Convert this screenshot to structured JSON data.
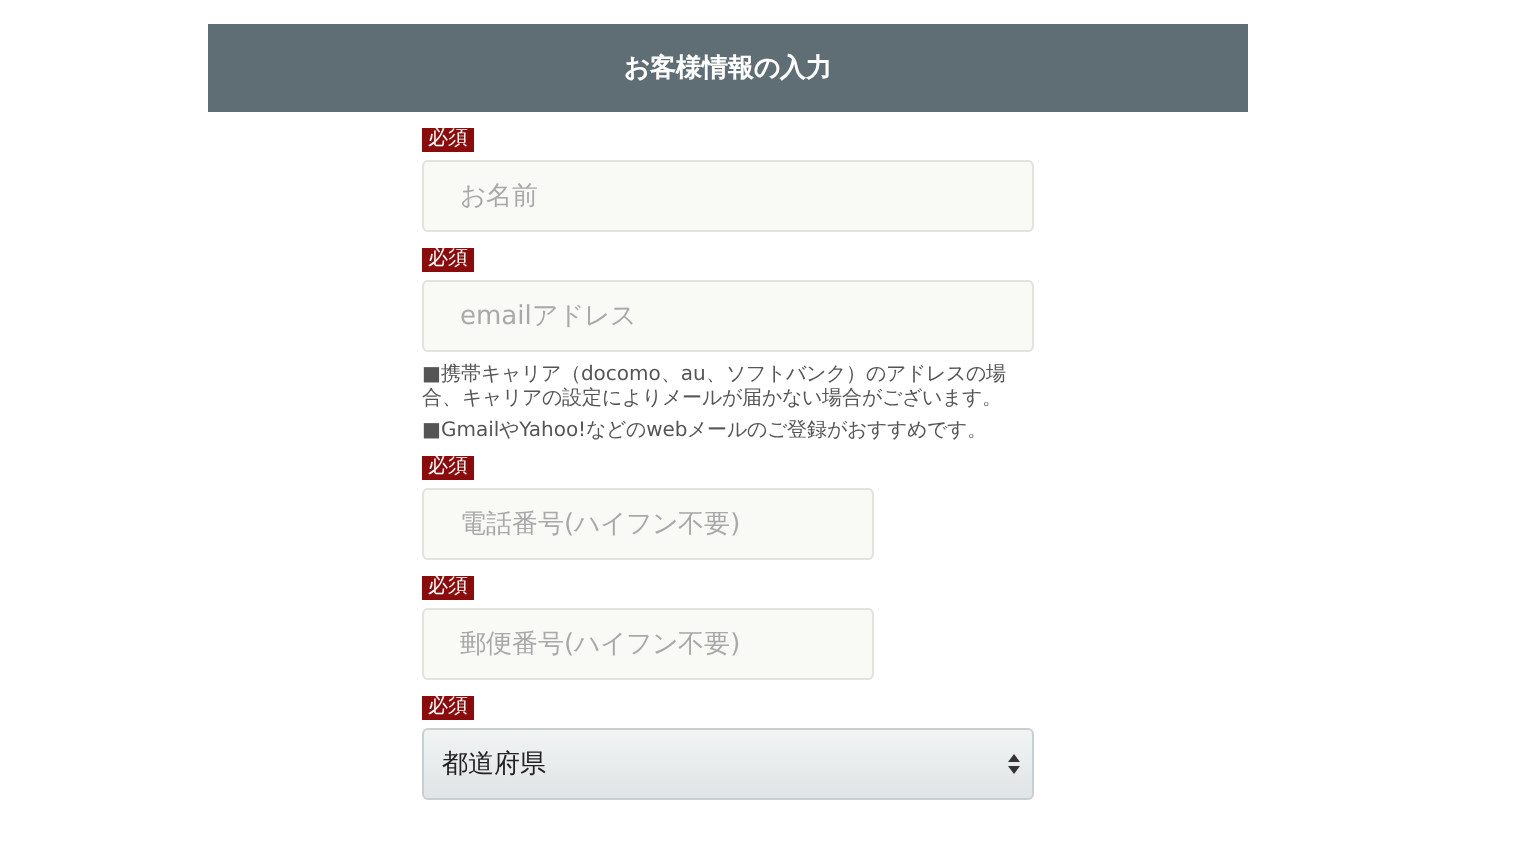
{
  "header": {
    "title": "お客様情報の入力"
  },
  "fields": [
    {
      "kind": "text",
      "badge": "必須",
      "placeholder": "お名前",
      "wide": true
    },
    {
      "kind": "text",
      "badge": "必須",
      "placeholder": "emailアドレス",
      "wide": true,
      "notes": [
        "■携帯キャリア（docomo、au、ソフトバンク）のアドレスの場合、キャリアの設定によりメールが届かない場合がございます。",
        "■GmailやYahoo!などのwebメールのご登録がおすすめです。"
      ]
    },
    {
      "kind": "text",
      "badge": "必須",
      "placeholder": "電話番号(ハイフン不要)",
      "wide": false
    },
    {
      "kind": "text",
      "badge": "必須",
      "placeholder": "郵便番号(ハイフン不要)",
      "wide": false
    },
    {
      "kind": "select",
      "badge": "必須",
      "value": "都道府県",
      "wide": true
    }
  ]
}
